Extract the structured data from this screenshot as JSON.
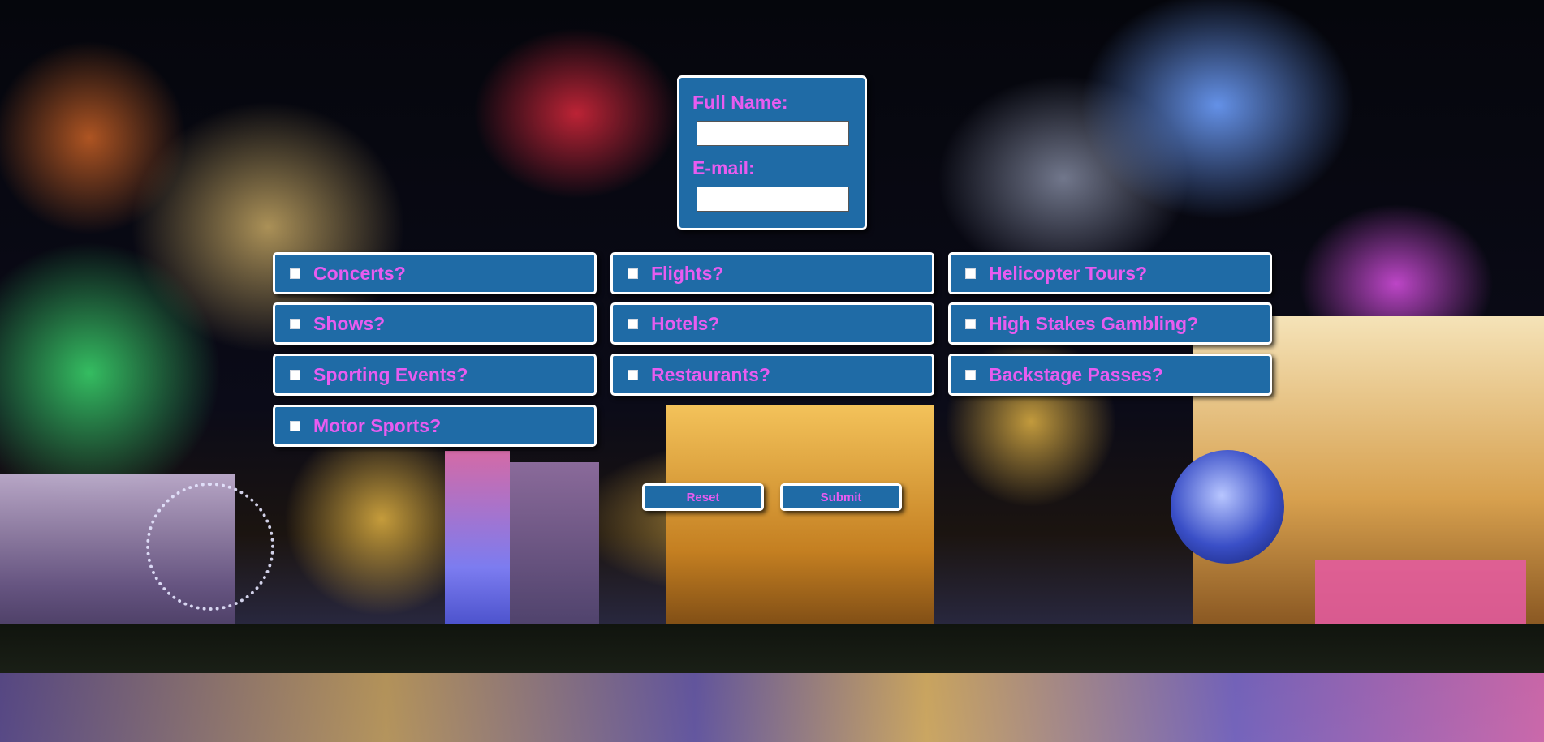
{
  "form": {
    "full_name_label": "Full Name:",
    "full_name_value": "",
    "email_label": "E-mail:",
    "email_value": ""
  },
  "options": [
    {
      "label": "Concerts?",
      "checked": false
    },
    {
      "label": "Flights?",
      "checked": false
    },
    {
      "label": "Helicopter Tours?",
      "checked": false
    },
    {
      "label": "Shows?",
      "checked": false
    },
    {
      "label": "Hotels?",
      "checked": false
    },
    {
      "label": "High Stakes Gambling?",
      "checked": false
    },
    {
      "label": "Sporting Events?",
      "checked": false
    },
    {
      "label": "Restaurants?",
      "checked": false
    },
    {
      "label": "Backstage Passes?",
      "checked": false
    },
    {
      "label": "Motor Sports?",
      "checked": false
    }
  ],
  "buttons": {
    "reset_label": "Reset",
    "submit_label": "Submit"
  },
  "colors": {
    "panel_background": "#1f6ba6",
    "label_text": "#e85cf0",
    "panel_border": "#ffffff"
  },
  "icons": {
    "background": "las-vegas-fireworks-image"
  }
}
